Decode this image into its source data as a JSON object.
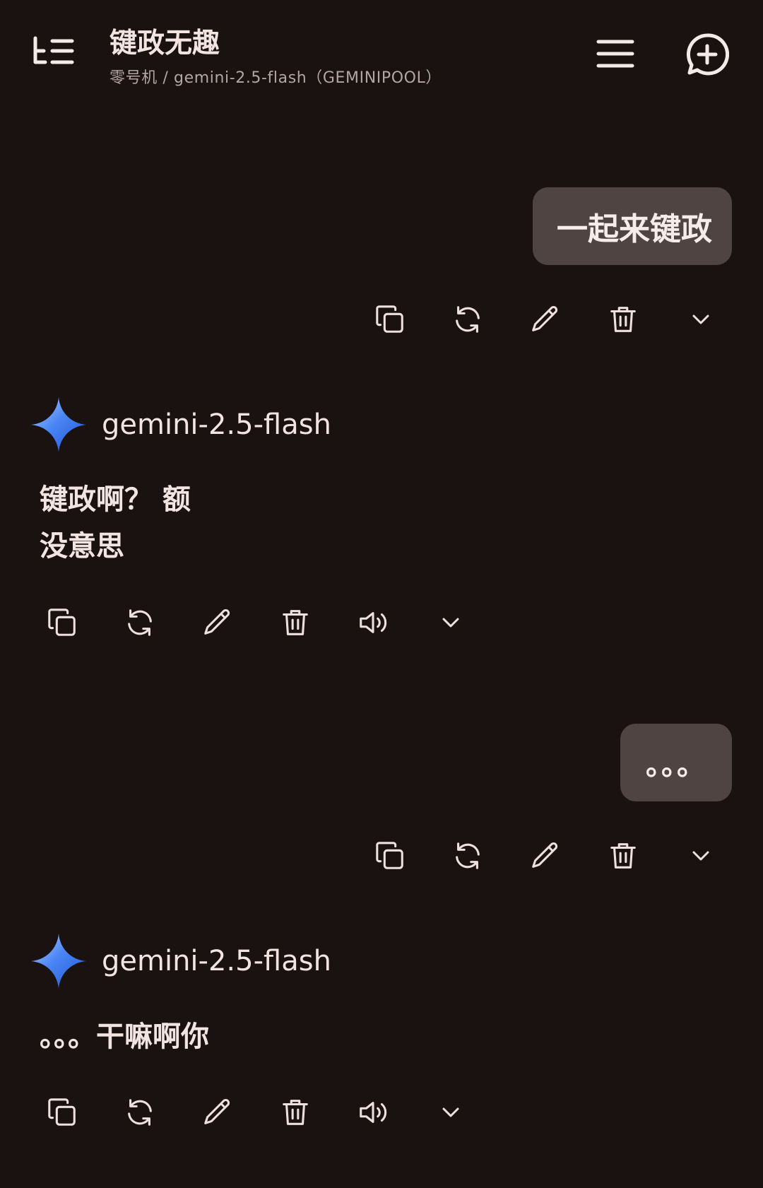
{
  "header": {
    "title": "键政无趣",
    "subtitle": "零号机 / gemini-2.5-flash（GEMINIPOOL）",
    "icons": {
      "left": "topics-list-icon",
      "menu": "hamburger-menu-icon",
      "new_chat": "new-chat-plus-icon"
    }
  },
  "messages": [
    {
      "role": "user",
      "text": "一起来键政",
      "actions": [
        "copy-icon",
        "regenerate-icon",
        "edit-icon",
        "delete-icon",
        "expand-chevron-icon"
      ]
    },
    {
      "role": "assistant",
      "model": "gemini-2.5-flash",
      "lines": [
        "键政啊？ 额",
        "没意思"
      ],
      "actions": [
        "copy-icon",
        "regenerate-icon",
        "edit-icon",
        "delete-icon",
        "speaker-icon",
        "expand-chevron-icon"
      ]
    },
    {
      "role": "user",
      "text": "。。。",
      "actions": [
        "copy-icon",
        "regenerate-icon",
        "edit-icon",
        "delete-icon",
        "expand-chevron-icon"
      ]
    },
    {
      "role": "assistant",
      "model": "gemini-2.5-flash",
      "lines": [
        "。。。干嘛啊你"
      ],
      "actions": [
        "copy-icon",
        "regenerate-icon",
        "edit-icon",
        "delete-icon",
        "speaker-icon",
        "expand-chevron-icon"
      ]
    }
  ],
  "colors": {
    "background": "#1a1111",
    "user_bubble": "#4f4442",
    "text": "#f1e4e1",
    "subtitle": "#b3a6a3",
    "gemini_gradient": [
      "#8ab4f8",
      "#4285f4",
      "#1a5bd6"
    ]
  }
}
